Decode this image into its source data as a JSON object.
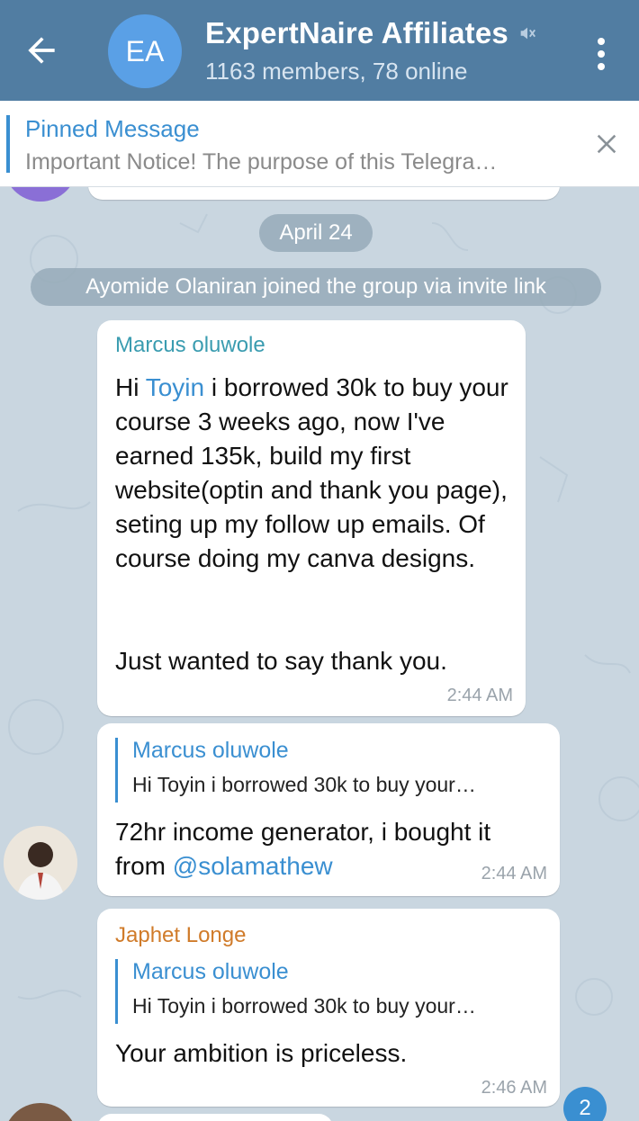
{
  "header": {
    "avatar_initials": "EA",
    "title": "ExpertNaire Affiliates",
    "subtitle": "1163 members, 78 online"
  },
  "pinned": {
    "title": "Pinned Message",
    "text": "Important Notice!   The purpose of this Telegra…"
  },
  "chat": {
    "date_badge": "April 24",
    "service_message": "Ayomide Olaniran joined the group via invite link",
    "messages": [
      {
        "sender": "Marcus oluwole",
        "mention": "Toyin",
        "text_before": "Hi ",
        "text_after": " i borrowed 30k to buy your course 3 weeks ago, now I've earned 135k, build my first website(optin and thank you page), seting up my follow up emails. Of course doing my canva designs.",
        "text_line2": "Just wanted to say thank you.",
        "time": "2:44 AM"
      },
      {
        "reply_name": "Marcus oluwole",
        "reply_text": "Hi Toyin i borrowed 30k to buy your…",
        "text": "72hr income generator, i bought it from ",
        "mention": "@solamathew",
        "time": "2:44 AM"
      },
      {
        "sender": "Japhet Longe",
        "reply_name": "Marcus oluwole",
        "reply_text": "Hi Toyin i borrowed 30k to buy your…",
        "text": "Your ambition is priceless.",
        "time": "2:46 AM"
      }
    ],
    "unread_badge": "2"
  },
  "colors": {
    "header": "#517da2",
    "accent": "#3a8fd1",
    "sender_marcus": "#3a9cb0",
    "sender_japhet": "#d07b2a",
    "chat_bg": "#c9d6e0"
  },
  "icons": [
    "back-arrow-icon",
    "mute-icon",
    "more-vert-icon",
    "close-icon"
  ]
}
